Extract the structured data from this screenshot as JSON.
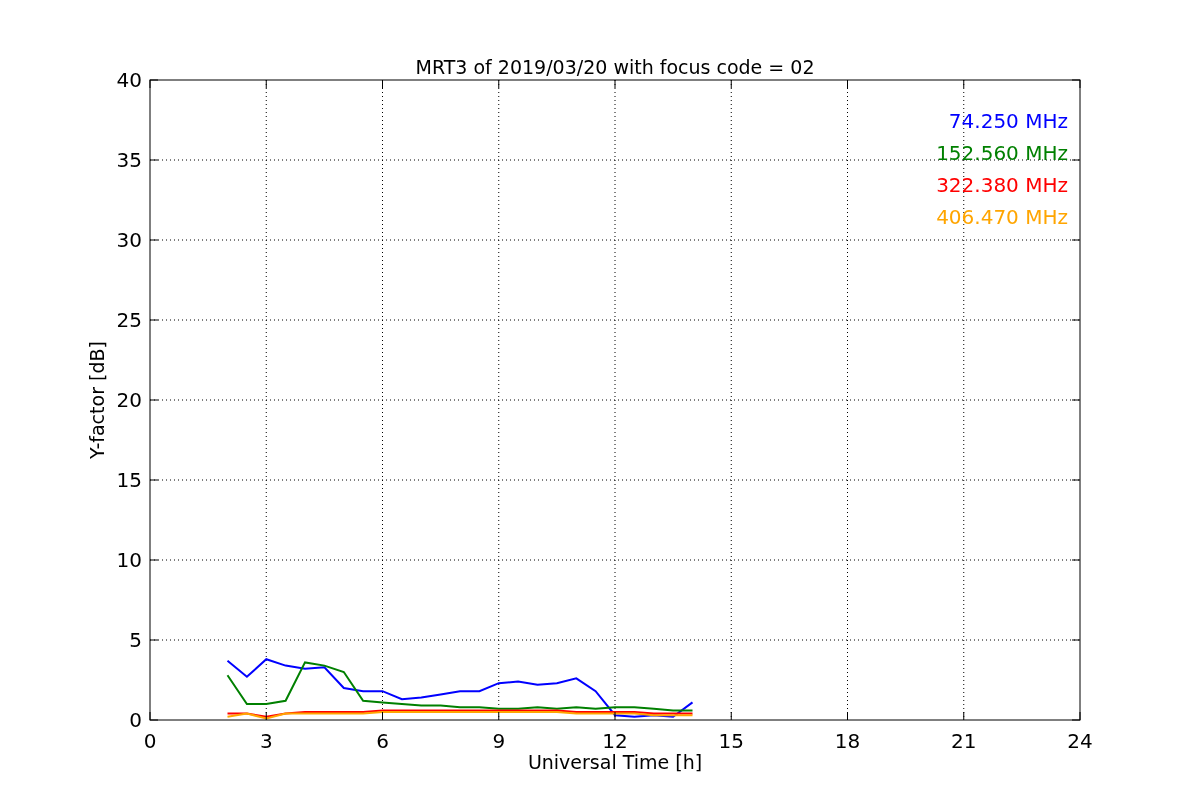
{
  "figure": {
    "chart_data": {
      "type": "line",
      "title": "MRT3 of 2019/03/20 with focus code = 02",
      "xlabel": "Universal Time [h]",
      "ylabel": "Y-factor [dB]",
      "x": [
        2,
        2.5,
        3,
        3.5,
        4,
        4.5,
        5,
        5.5,
        6,
        6.5,
        7,
        7.5,
        8,
        8.5,
        9,
        9.5,
        10,
        10.5,
        11,
        11.5,
        12,
        12.5,
        13,
        13.5,
        14
      ],
      "series": [
        {
          "name": "74.250 MHz",
          "color": "#0000ff",
          "values": [
            3.7,
            2.7,
            3.8,
            3.4,
            3.2,
            3.3,
            2.0,
            1.8,
            1.8,
            1.3,
            1.4,
            1.6,
            1.8,
            1.8,
            2.3,
            2.4,
            2.2,
            2.3,
            2.6,
            1.8,
            0.3,
            0.2,
            0.3,
            0.2,
            1.1
          ]
        },
        {
          "name": "152.560 MHz",
          "color": "#008000",
          "values": [
            2.8,
            1.0,
            1.0,
            1.2,
            3.6,
            3.4,
            3.0,
            1.2,
            1.1,
            1.0,
            0.9,
            0.9,
            0.8,
            0.8,
            0.7,
            0.7,
            0.8,
            0.7,
            0.8,
            0.7,
            0.8,
            0.8,
            0.7,
            0.6,
            0.6
          ]
        },
        {
          "name": "322.380 MHz",
          "color": "#ff0000",
          "values": [
            0.4,
            0.4,
            0.2,
            0.4,
            0.5,
            0.5,
            0.5,
            0.5,
            0.6,
            0.6,
            0.6,
            0.6,
            0.6,
            0.6,
            0.6,
            0.6,
            0.6,
            0.6,
            0.5,
            0.5,
            0.5,
            0.5,
            0.4,
            0.4,
            0.4
          ]
        },
        {
          "name": "406.470 MHz",
          "color": "#ffa500",
          "values": [
            0.2,
            0.4,
            0.1,
            0.4,
            0.4,
            0.4,
            0.4,
            0.4,
            0.5,
            0.5,
            0.5,
            0.5,
            0.5,
            0.5,
            0.5,
            0.5,
            0.5,
            0.5,
            0.4,
            0.4,
            0.4,
            0.4,
            0.3,
            0.3,
            0.3
          ]
        }
      ],
      "grid": true,
      "xlim": [
        0,
        24
      ],
      "ylim": [
        0,
        40
      ],
      "xticks": [
        0,
        3,
        6,
        9,
        12,
        15,
        18,
        21,
        24
      ],
      "yticks": [
        0,
        5,
        10,
        15,
        20,
        25,
        30,
        35,
        40
      ]
    }
  }
}
